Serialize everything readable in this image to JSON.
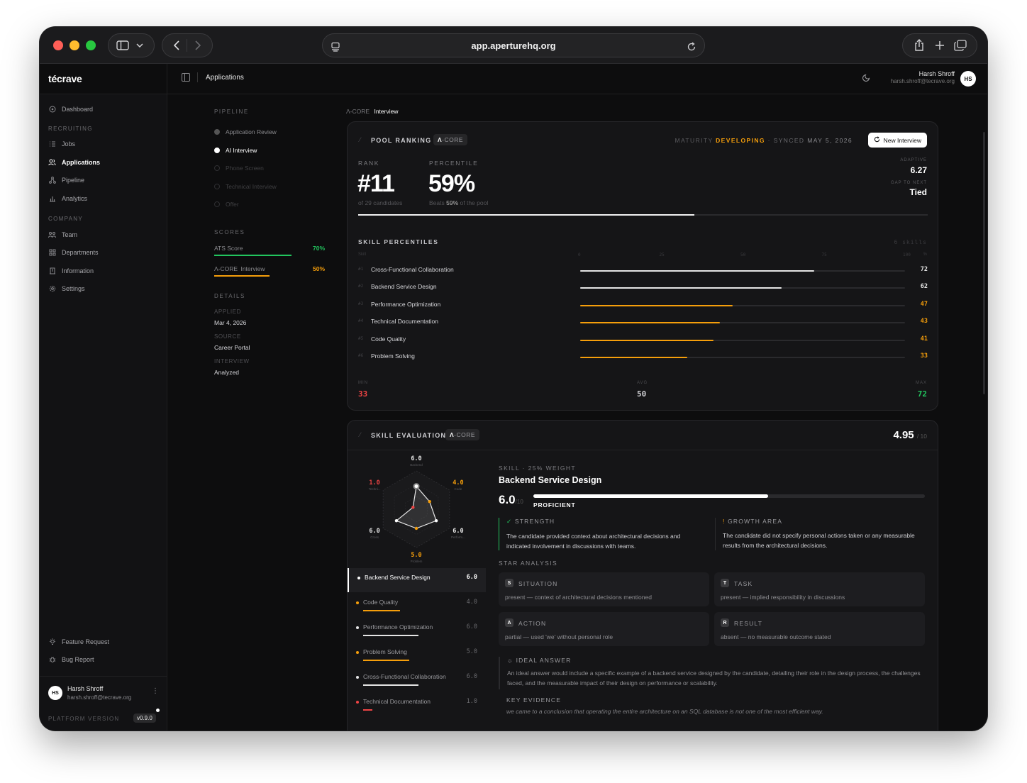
{
  "browser": {
    "url": "app.aperturehq.org"
  },
  "app": {
    "brand": "técrave",
    "breadcrumb": "Applications"
  },
  "user": {
    "name": "Harsh Shroff",
    "email": "harsh.shroff@tecrave.org",
    "initials": "HS"
  },
  "sidebar": {
    "dashboard": "Dashboard",
    "recruiting_label": "RECRUITING",
    "jobs": "Jobs",
    "applications": "Applications",
    "pipeline": "Pipeline",
    "analytics": "Analytics",
    "company_label": "COMPANY",
    "team": "Team",
    "departments": "Departments",
    "information": "Information",
    "settings": "Settings",
    "feature_request": "Feature Request",
    "bug_report": "Bug Report",
    "platform_version_label": "PLATFORM VERSION",
    "version": "v0.9.0"
  },
  "pipeline": {
    "label": "PIPELINE",
    "stages": [
      "Application Review",
      "AI Interview",
      "Phone Screen",
      "Technical Interview",
      "Offer"
    ]
  },
  "scores": {
    "label": "SCORES",
    "ats_label": "ATS Score",
    "ats_value": "70%",
    "ats_fraction": 0.7,
    "ats_color": "#22c55e",
    "core_label": "Λ-CORE",
    "core_suffix": "Interview",
    "core_value": "50%",
    "core_fraction": 0.5,
    "core_color": "#f59e0b"
  },
  "details": {
    "label": "DETAILS",
    "applied_k": "APPLIED",
    "applied_v": "Mar 4, 2026",
    "source_k": "SOURCE",
    "source_v": "Career Portal",
    "interview_k": "INTERVIEW",
    "interview_v": "Analyzed"
  },
  "crumb": {
    "a": "Λ-CORE",
    "b": "Interview"
  },
  "ranking": {
    "title": "POOL RANKING",
    "tag_bold": "Λ",
    "tag_rest": "-CORE",
    "maturity_label": "MATURITY",
    "maturity_value": "DEVELOPING",
    "synced_label": "SYNCED",
    "synced_date": "MAY 5, 2026",
    "new_button": "New Interview",
    "rank_label": "RANK",
    "rank_value": "#11",
    "rank_note": "of 29 candidates",
    "percentile_label": "PERCENTILE",
    "percentile_value": "59%",
    "percentile_note_a": "Beats",
    "percentile_note_b": "59%",
    "percentile_note_c": "of the pool",
    "percentile_fraction": 0.59,
    "adaptive_label": "ADAPTIVE",
    "adaptive_value": "6.27",
    "gap_label": "GAP TO NEXT",
    "gap_value": "Tied"
  },
  "skill_percentiles": {
    "title": "SKILL PERCENTILES",
    "count": "6 skills",
    "axis_skill": "Skill",
    "axis_ticks": [
      "0",
      "25",
      "50",
      "75",
      "100"
    ],
    "axis_pct": "%",
    "ranks": [
      "#1",
      "#2",
      "#3",
      "#4",
      "#5",
      "#6"
    ],
    "skills": [
      "Cross-Functional Collaboration",
      "Backend Service Design",
      "Performance Optimization",
      "Technical Documentation",
      "Code Quality",
      "Problem Solving"
    ],
    "values": [
      72,
      62,
      47,
      43,
      41,
      33
    ],
    "min_label": "MIN",
    "min_value": "33",
    "avg_label": "AVG",
    "avg_value": "50",
    "max_label": "MAX",
    "max_value": "72",
    "colors": {
      "high": "#e5e5e5",
      "mid": "#f59e0b",
      "min": "#ef4444",
      "max": "#22c55e"
    }
  },
  "evaluation": {
    "title": "SKILL EVALUATION",
    "tag_bold": "Λ",
    "tag_rest": "-CORE",
    "overall": "4.95",
    "overall_max": "/ 10",
    "radar": {
      "axes": [
        "Backend",
        "Code",
        "Perform...",
        "Problem",
        "Cross",
        "Techni..."
      ],
      "values": [
        6.0,
        4.0,
        6.0,
        5.0,
        6.0,
        1.0
      ],
      "labels": [
        "6.0",
        "4.0",
        "6.0",
        "5.0",
        "6.0",
        "1.0"
      ],
      "max": 10
    },
    "list": [
      {
        "name": "Backend Service Design",
        "score": "6.0",
        "value": 6.0
      },
      {
        "name": "Code Quality",
        "score": "4.0",
        "value": 4.0
      },
      {
        "name": "Performance Optimization",
        "score": "6.0",
        "value": 6.0
      },
      {
        "name": "Problem Solving",
        "score": "5.0",
        "value": 5.0
      },
      {
        "name": "Cross-Functional Collaboration",
        "score": "6.0",
        "value": 6.0
      },
      {
        "name": "Technical Documentation",
        "score": "1.0",
        "value": 1.0
      }
    ],
    "detail": {
      "kicker": "SKILL · 25% WEIGHT",
      "title": "Backend Service Design",
      "score": "6.0",
      "score_max": "/10",
      "level": "PROFICIENT",
      "fraction": 0.6,
      "strength_label": "STRENGTH",
      "strength_text": "The candidate provided context about architectural decisions and indicated involvement in discussions with teams.",
      "growth_label": "GROWTH AREA",
      "growth_text": "The candidate did not specify personal actions taken or any measurable results from the architectural decisions.",
      "star_label": "STAR ANALYSIS",
      "star": [
        {
          "letter": "S",
          "title": "SITUATION",
          "text": "present — context of architectural decisions mentioned"
        },
        {
          "letter": "T",
          "title": "TASK",
          "text": "present — implied responsibility in discussions"
        },
        {
          "letter": "A",
          "title": "ACTION",
          "text": "partial — used 'we' without personal role"
        },
        {
          "letter": "R",
          "title": "RESULT",
          "text": "absent — no measurable outcome stated"
        }
      ],
      "ideal_label": "IDEAL ANSWER",
      "ideal_text": "An ideal answer would include a specific example of a backend service designed by the candidate, detailing their role in the design process, the challenges faced, and the measurable impact of their design on performance or scalability.",
      "evidence_label": "KEY EVIDENCE",
      "evidence_text": "we came to a conclusion that operating the entire architecture on an SQL database is not one of the most efficient way."
    }
  }
}
